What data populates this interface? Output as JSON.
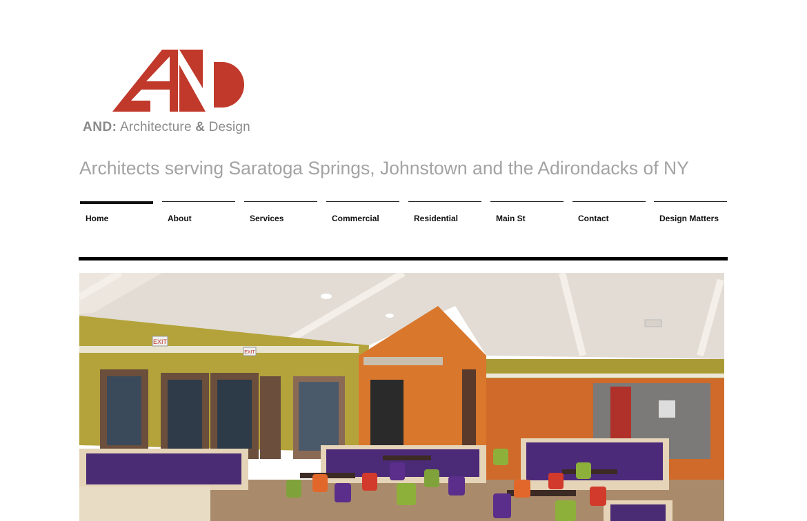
{
  "logo": {
    "brand": "AND:",
    "name_part1": "Architecture",
    "amp": "&",
    "name_part2": "Design",
    "mark_color": "#c0392b"
  },
  "tagline": "Architects serving Saratoga Springs, Johnstown and the Adirondacks of NY",
  "nav": {
    "items": [
      {
        "label": "Home",
        "active": true
      },
      {
        "label": "About"
      },
      {
        "label": "Services"
      },
      {
        "label": "Commercial"
      },
      {
        "label": "Residential"
      },
      {
        "label": "Main St"
      },
      {
        "label": "Contact"
      },
      {
        "label": "Design Matters"
      }
    ]
  },
  "hero": {
    "exit_sign_1": "EXIT",
    "exit_sign_2": "EXIT"
  },
  "colors": {
    "accent": "#c0392b",
    "text_gray": "#8a8a8a",
    "tagline_gray": "#a3a3a3"
  }
}
